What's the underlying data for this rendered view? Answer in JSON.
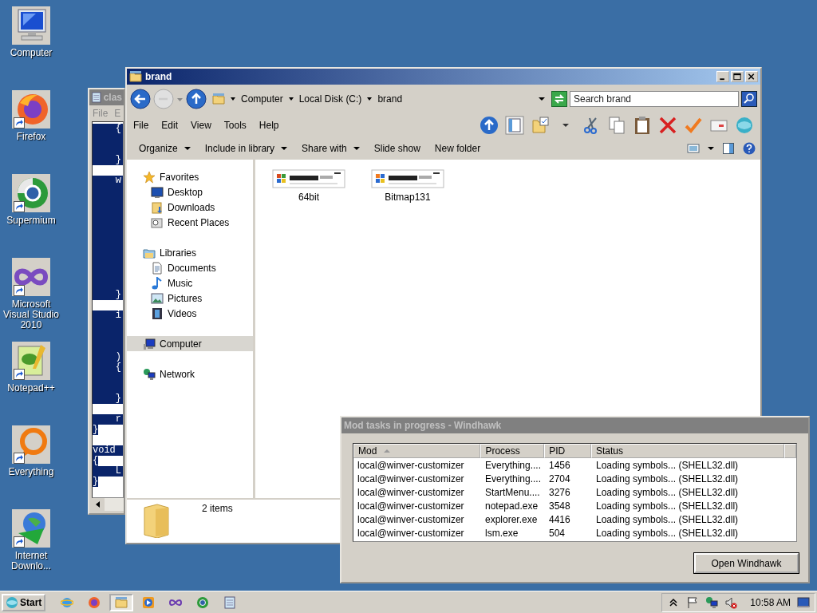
{
  "desktop": {
    "icons": [
      {
        "label": "Computer",
        "kind": "computer",
        "shortcut": false
      },
      {
        "label": "Firefox",
        "kind": "firefox",
        "shortcut": true
      },
      {
        "label": "Supermium",
        "kind": "supermium",
        "shortcut": true
      },
      {
        "label": "Microsoft Visual Studio 2010",
        "kind": "vs",
        "shortcut": true
      },
      {
        "label": "Notepad++",
        "kind": "notepadpp",
        "shortcut": true
      },
      {
        "label": "Everything",
        "kind": "everything",
        "shortcut": true
      },
      {
        "label": "Internet Downlo...",
        "kind": "idm",
        "shortcut": true
      }
    ]
  },
  "notepad": {
    "title": "clas",
    "menu": [
      "File",
      "E"
    ],
    "lines": [
      {
        "text": "    {",
        "selected": true,
        "partial": false
      },
      {
        "selected": true,
        "partial": false
      },
      {
        "selected": true,
        "partial": false
      },
      {
        "text": "    }",
        "selected": true,
        "partial": false
      },
      {
        "selected": false
      },
      {
        "text": "    w",
        "selected": true,
        "partial": false
      },
      {
        "selected": true,
        "partial": false
      },
      {
        "selected": true,
        "partial": false
      },
      {
        "selected": true,
        "partial": false
      },
      {
        "selected": true,
        "partial": false
      },
      {
        "selected": true,
        "partial": false
      },
      {
        "selected": true,
        "partial": false
      },
      {
        "selected": true,
        "partial": false
      },
      {
        "selected": true,
        "partial": false
      },
      {
        "selected": true,
        "partial": false
      },
      {
        "selected": true,
        "partial": false
      },
      {
        "text": "    }",
        "selected": true,
        "partial": false
      },
      {
        "selected": false
      },
      {
        "text": "    i",
        "selected": true,
        "partial": false
      },
      {
        "selected": true,
        "partial": false
      },
      {
        "selected": true,
        "partial": false
      },
      {
        "selected": true,
        "partial": false
      },
      {
        "text": "    )",
        "selected": true,
        "partial": false
      },
      {
        "text": "    {",
        "selected": true,
        "partial": false
      },
      {
        "selected": true,
        "partial": false
      },
      {
        "selected": true,
        "partial": false
      },
      {
        "text": "    }",
        "selected": true,
        "partial": false
      },
      {
        "selected": false
      },
      {
        "text": "    r",
        "selected": true,
        "partial": false
      },
      {
        "text": "}",
        "selected": true,
        "partial": true
      },
      {
        "selected": false
      },
      {
        "text": "void",
        "selected": true,
        "partial": false
      },
      {
        "text": "{",
        "selected": true,
        "partial": true
      },
      {
        "text": "    L",
        "selected": true,
        "partial": false
      },
      {
        "text": "}",
        "selected": true,
        "partial": true
      }
    ]
  },
  "explorer": {
    "title": "brand",
    "breadcrumb": [
      "Computer",
      "Local Disk (C:)",
      "brand"
    ],
    "search": {
      "placeholder": "Search brand"
    },
    "menu": [
      "File",
      "Edit",
      "View",
      "Tools",
      "Help"
    ],
    "commands": [
      {
        "label": "Organize",
        "dropdown": true
      },
      {
        "label": "Include in library",
        "dropdown": true
      },
      {
        "label": "Share with",
        "dropdown": true
      },
      {
        "label": "Slide show",
        "dropdown": false
      },
      {
        "label": "New folder",
        "dropdown": false
      }
    ],
    "nav": [
      {
        "label": "Favorites",
        "kind": "favorites",
        "selected": false,
        "children": [
          {
            "label": "Desktop",
            "kind": "desktop",
            "selected": false
          },
          {
            "label": "Downloads",
            "kind": "downloads",
            "selected": false
          },
          {
            "label": "Recent Places",
            "kind": "recent",
            "selected": false
          }
        ]
      },
      {
        "label": "Libraries",
        "kind": "libraries",
        "selected": false,
        "children": [
          {
            "label": "Documents",
            "kind": "documents",
            "selected": false
          },
          {
            "label": "Music",
            "kind": "music",
            "selected": false
          },
          {
            "label": "Pictures",
            "kind": "pictures",
            "selected": false
          },
          {
            "label": "Videos",
            "kind": "videos",
            "selected": false
          }
        ]
      },
      {
        "label": "Computer",
        "kind": "computer",
        "selected": true
      },
      {
        "label": "Network",
        "kind": "network",
        "selected": false
      }
    ],
    "files": [
      {
        "name": "64bit",
        "kind": "picture"
      },
      {
        "name": "Bitmap131",
        "kind": "picture"
      }
    ],
    "status": "2 items"
  },
  "windhawk": {
    "title": "Mod tasks in progress - Windhawk",
    "columns": [
      {
        "label": "Mod",
        "sorted": true
      },
      {
        "label": "Process",
        "sorted": false
      },
      {
        "label": "PID",
        "sorted": false
      },
      {
        "label": "Status",
        "sorted": false
      }
    ],
    "rows": [
      [
        "local@winver-customizer",
        "Everything....",
        "1456",
        "Loading symbols... (SHELL32.dll)"
      ],
      [
        "local@winver-customizer",
        "Everything....",
        "2704",
        "Loading symbols... (SHELL32.dll)"
      ],
      [
        "local@winver-customizer",
        "StartMenu....",
        "3276",
        "Loading symbols... (SHELL32.dll)"
      ],
      [
        "local@winver-customizer",
        "notepad.exe",
        "3548",
        "Loading symbols... (SHELL32.dll)"
      ],
      [
        "local@winver-customizer",
        "explorer.exe",
        "4416",
        "Loading symbols... (SHELL32.dll)"
      ],
      [
        "local@winver-customizer",
        "lsm.exe",
        "504",
        "Loading symbols... (SHELL32.dll)"
      ]
    ],
    "button": "Open Windhawk"
  },
  "taskbar": {
    "start": "Start",
    "apps": [
      {
        "kind": "ie",
        "active": false
      },
      {
        "kind": "firefox",
        "active": false
      },
      {
        "kind": "explorer",
        "active": true
      },
      {
        "kind": "media",
        "active": false
      },
      {
        "kind": "vs",
        "active": false
      },
      {
        "kind": "supermium",
        "active": false
      },
      {
        "kind": "notepad",
        "active": false
      }
    ],
    "tray": [
      {
        "kind": "chevron"
      },
      {
        "kind": "flag"
      },
      {
        "kind": "network"
      },
      {
        "kind": "muted"
      }
    ],
    "clock": "10:58 AM"
  }
}
